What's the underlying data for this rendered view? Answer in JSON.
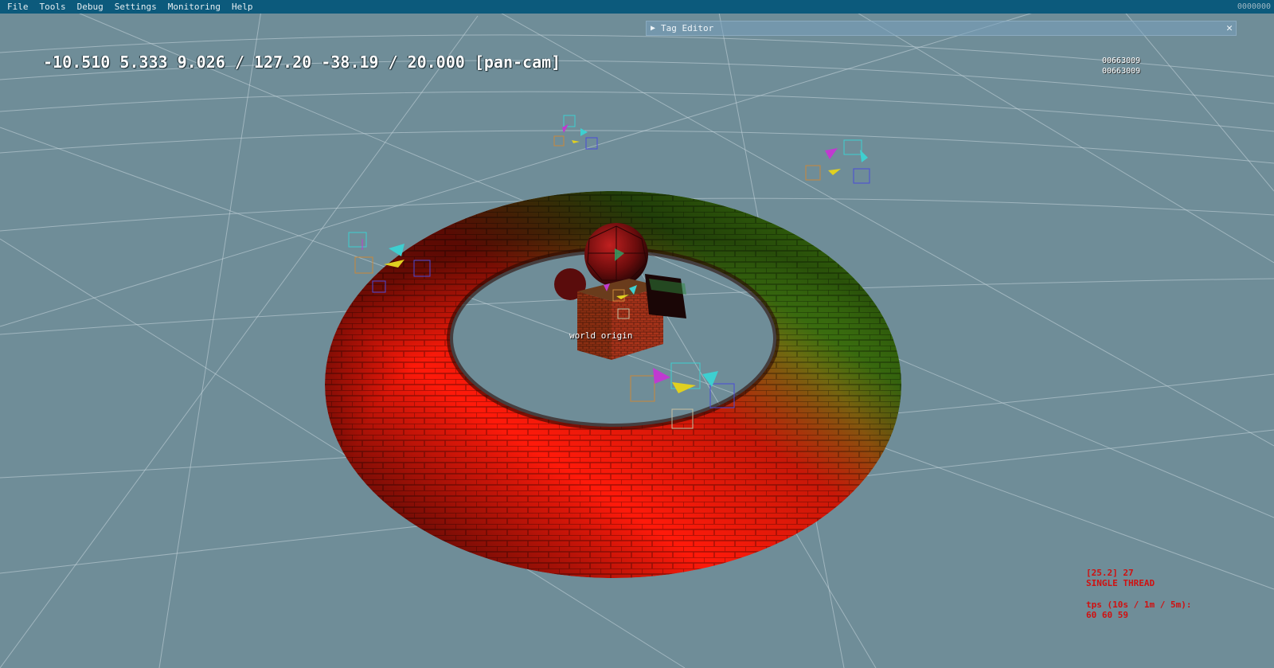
{
  "menubar": {
    "items": [
      "File",
      "Tools",
      "Debug",
      "Settings",
      "Monitoring",
      "Help"
    ],
    "counter": "0000000"
  },
  "tag_editor": {
    "title": "Tag Editor",
    "close_glyph": "✕",
    "arrow_glyph": "▶"
  },
  "hud": {
    "camera_readout": "-10.510 5.333 9.026 / 127.20 -38.19 / 20.000 [pan-cam]",
    "id_line_1": "00663009",
    "id_line_2": "00663009",
    "world_origin_label": "world origin",
    "stats": {
      "line1": "[25.2] 27",
      "line2": "SINGLE THREAD",
      "line3": "tps (10s / 1m / 5m):",
      "line4": "60 60 59"
    }
  },
  "colors": {
    "background": "#6f8d98",
    "menubar": "#0c5a7c",
    "stats_text": "#d01010",
    "torus_red": "#ff1a0a",
    "torus_green": "#6fdc1a"
  },
  "icons": {
    "tag_editor_arrow": "play-triangle-icon",
    "tag_editor_close": "close-icon"
  }
}
